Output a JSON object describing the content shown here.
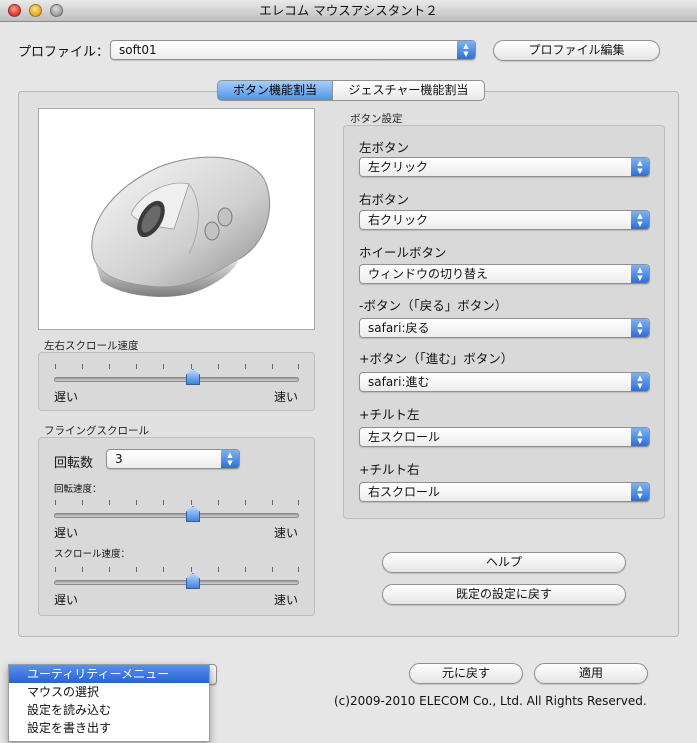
{
  "window": {
    "title": "エレコム マウスアシスタント２"
  },
  "profile": {
    "label": "プロファイル：",
    "value": "soft01",
    "edit_button": "プロファイル編集"
  },
  "tabs": [
    {
      "label": "ボタン機能割当",
      "active": true
    },
    {
      "label": "ジェスチャー機能割当",
      "active": false
    }
  ],
  "scroll_speed": {
    "title": "左右スクロール速度",
    "slow": "遅い",
    "fast": "速い",
    "level": 0.5
  },
  "flying_scroll": {
    "title": "フライングスクロール",
    "rotations_label": "回転数",
    "rotations_value": "3",
    "rotation_speed_label": "回転速度：",
    "rotation_speed_level": 0.5,
    "scroll_speed_label": "スクロール速度：",
    "scroll_speed_level": 0.5,
    "slow": "遅い",
    "fast": "速い"
  },
  "button_settings": {
    "title": "ボタン設定",
    "items": [
      {
        "label": "左ボタン",
        "value": "左クリック"
      },
      {
        "label": "右ボタン",
        "value": "右クリック"
      },
      {
        "label": "ホイールボタン",
        "value": "ウィンドウの切り替え"
      },
      {
        "label": "-ボタン（「戻る」ボタン）",
        "value": "safari:戻る"
      },
      {
        "label": "+ボタン（「進む」ボタン）",
        "value": "safari:進む"
      },
      {
        "label": "+チルト左",
        "value": "左スクロール"
      },
      {
        "label": "+チルト右",
        "value": "右スクロール"
      }
    ]
  },
  "actions": {
    "help": "ヘルプ",
    "defaults": "既定の設定に戻す",
    "revert": "元に戻す",
    "apply": "適用"
  },
  "utility_menu": {
    "items": [
      "ユーティリティーメニュー",
      "マウスの選択",
      "設定を読み込む",
      "設定を書き出す"
    ],
    "selected_index": 0
  },
  "copyright": "(c)2009-2010 ELECOM Co., Ltd. All Rights Reserved."
}
